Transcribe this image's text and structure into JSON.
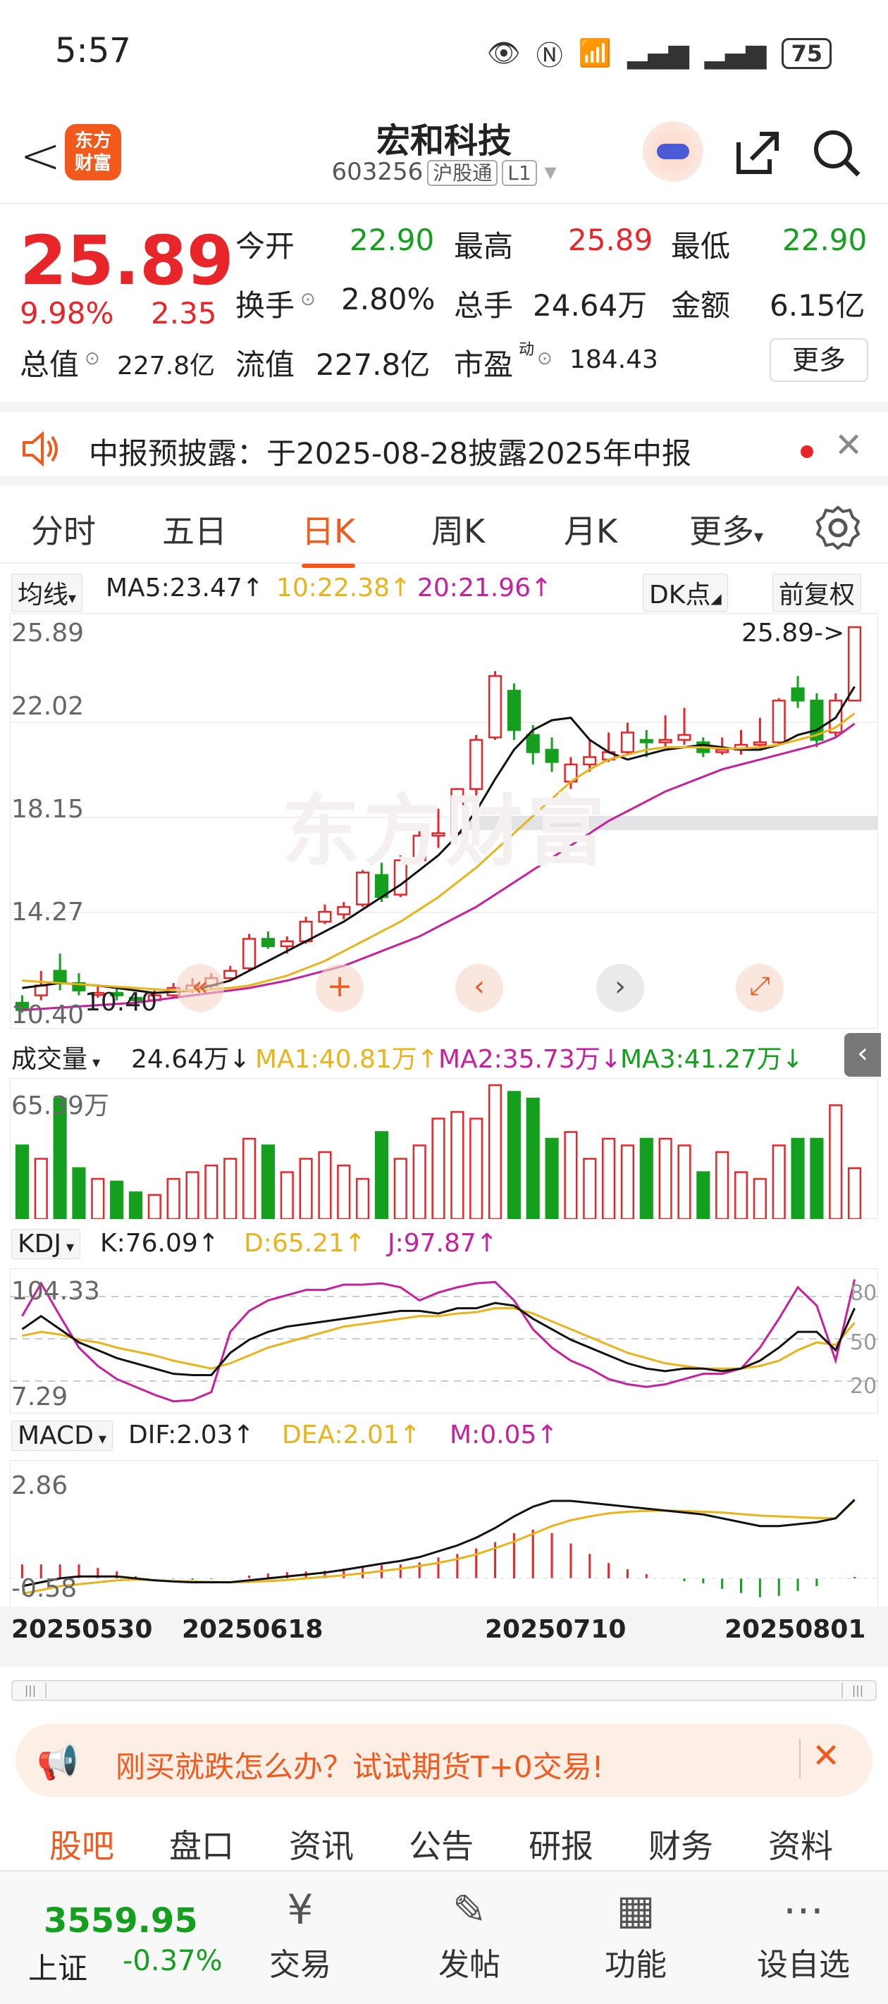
{
  "status_bar": {
    "time": "5:57",
    "battery": "75"
  },
  "header": {
    "back": "<",
    "logo_line1": "东方",
    "logo_line2": "财富",
    "title": "宏和科技",
    "code": "603256",
    "tag1": "沪股通",
    "tag2": "L1"
  },
  "quote": {
    "price": "25.89",
    "pct": "9.98%",
    "change": "2.35",
    "open_label": "今开",
    "open": "22.90",
    "high_label": "最高",
    "high": "25.89",
    "low_label": "最低",
    "low": "22.90",
    "turnover_label": "换手",
    "turnover": "2.80%",
    "volume_label": "总手",
    "volume": "24.64万",
    "amount_label": "金额",
    "amount": "6.15亿",
    "mcap_label": "总值",
    "mcap": "227.8亿",
    "float_label": "流值",
    "float": "227.8亿",
    "pe_label": "市盈",
    "pe_sup": "动",
    "pe": "184.43",
    "more": "更多"
  },
  "notice": {
    "text": "中报预披露：于2025-08-28披露2025年中报"
  },
  "tabs": [
    "分时",
    "五日",
    "日K",
    "周K",
    "月K",
    "更多"
  ],
  "active_tab": "日K",
  "ma_bar": {
    "select": "均线",
    "ma5": "MA5:23.47↑",
    "ma10": "10:22.38↑",
    "ma20": "20:21.96↑",
    "dk": "DK点",
    "fq": "前复权"
  },
  "kline": {
    "ylabels": [
      "25.89",
      "22.02",
      "18.15",
      "14.27",
      "10.40"
    ],
    "last_label": "25.89->",
    "low_label": "10.40",
    "watermark": "东方财富"
  },
  "vol_bar": {
    "select": "成交量",
    "vol": "24.64万↓",
    "ma1": "MA1:40.81万↑",
    "ma2": "MA2:35.73万↓",
    "ma3": "MA3:41.27万↓",
    "ymax": "65.39万"
  },
  "kdj_bar": {
    "select": "KDJ",
    "k": "K:76.09↑",
    "d": "D:65.21↑",
    "j": "J:97.87↑",
    "ymax": "104.33",
    "ymin": "7.29",
    "r80": "80",
    "r50": "50",
    "r20": "20"
  },
  "macd_bar": {
    "select": "MACD",
    "dif": "DIF:2.03↑",
    "dea": "DEA:2.01↑",
    "m": "M:0.05↑",
    "ymax": "2.86",
    "ymin": "-0.58"
  },
  "dates": [
    "20250530",
    "20250618",
    "20250710",
    "20250801"
  ],
  "banner": {
    "text": "刚买就跌怎么办？试试期货T+0交易!"
  },
  "subtabs": [
    "股吧",
    "盘口",
    "资讯",
    "公告",
    "研报",
    "财务",
    "资料"
  ],
  "index": {
    "value": "3559.95",
    "name": "上证",
    "pct": "-0.37%"
  },
  "bottom_nav": [
    {
      "label": "交易",
      "icon": "yen-icon"
    },
    {
      "label": "发帖",
      "icon": "edit-icon"
    },
    {
      "label": "功能",
      "icon": "grid-icon"
    },
    {
      "label": "设自选",
      "icon": "more-icon"
    }
  ],
  "colors": {
    "up": "#e8262a",
    "down": "#14a01e",
    "accent": "#f25a1d",
    "ma5": "#111111",
    "ma10": "#e8b41a",
    "ma20": "#c8209c"
  },
  "chart_data": {
    "type": "candlestick",
    "ylim": [
      10.4,
      25.89
    ],
    "dates_shown": [
      "20250530",
      "20250618",
      "20250710",
      "20250801"
    ],
    "candles": [
      {
        "o": 10.6,
        "c": 10.3,
        "h": 10.9,
        "l": 10.2
      },
      {
        "o": 10.9,
        "c": 11.3,
        "h": 11.9,
        "l": 10.7
      },
      {
        "o": 11.9,
        "c": 11.4,
        "h": 12.6,
        "l": 11.1
      },
      {
        "o": 11.4,
        "c": 11.1,
        "h": 11.8,
        "l": 10.9
      },
      {
        "o": 11.0,
        "c": 11.0,
        "h": 11.3,
        "l": 10.8
      },
      {
        "o": 11.0,
        "c": 10.9,
        "h": 11.2,
        "l": 10.7
      },
      {
        "o": 10.8,
        "c": 10.7,
        "h": 11.0,
        "l": 10.5
      },
      {
        "o": 10.7,
        "c": 10.9,
        "h": 11.1,
        "l": 10.6
      },
      {
        "o": 10.9,
        "c": 11.2,
        "h": 11.4,
        "l": 10.8
      },
      {
        "o": 11.1,
        "c": 11.3,
        "h": 11.6,
        "l": 11.0
      },
      {
        "o": 11.3,
        "c": 11.6,
        "h": 11.8,
        "l": 11.2
      },
      {
        "o": 11.6,
        "c": 11.9,
        "h": 12.1,
        "l": 11.5
      },
      {
        "o": 12.0,
        "c": 13.2,
        "h": 13.4,
        "l": 11.9
      },
      {
        "o": 13.2,
        "c": 12.9,
        "h": 13.5,
        "l": 12.8
      },
      {
        "o": 12.9,
        "c": 13.1,
        "h": 13.3,
        "l": 12.6
      },
      {
        "o": 13.1,
        "c": 13.9,
        "h": 14.1,
        "l": 13.0
      },
      {
        "o": 13.9,
        "c": 14.3,
        "h": 14.6,
        "l": 13.8
      },
      {
        "o": 14.2,
        "c": 14.5,
        "h": 14.7,
        "l": 14.0
      },
      {
        "o": 14.6,
        "c": 15.9,
        "h": 16.0,
        "l": 14.5
      },
      {
        "o": 15.8,
        "c": 14.9,
        "h": 16.3,
        "l": 14.7
      },
      {
        "o": 15.0,
        "c": 16.4,
        "h": 16.6,
        "l": 14.9
      },
      {
        "o": 16.4,
        "c": 17.4,
        "h": 17.6,
        "l": 16.3
      },
      {
        "o": 17.4,
        "c": 17.5,
        "h": 18.5,
        "l": 16.9
      },
      {
        "o": 17.5,
        "c": 19.3,
        "h": 19.3,
        "l": 17.4
      },
      {
        "o": 19.3,
        "c": 21.3,
        "h": 21.5,
        "l": 18.6
      },
      {
        "o": 21.4,
        "c": 23.9,
        "h": 24.1,
        "l": 21.3
      },
      {
        "o": 23.3,
        "c": 21.7,
        "h": 23.6,
        "l": 21.3
      },
      {
        "o": 21.5,
        "c": 20.8,
        "h": 21.9,
        "l": 20.3
      },
      {
        "o": 20.9,
        "c": 20.4,
        "h": 21.4,
        "l": 20.0
      },
      {
        "o": 19.6,
        "c": 20.3,
        "h": 20.6,
        "l": 19.3
      },
      {
        "o": 20.3,
        "c": 20.6,
        "h": 21.3,
        "l": 20.0
      },
      {
        "o": 20.5,
        "c": 20.8,
        "h": 21.6,
        "l": 20.4
      },
      {
        "o": 20.8,
        "c": 21.6,
        "h": 22.0,
        "l": 20.7
      },
      {
        "o": 21.3,
        "c": 21.2,
        "h": 21.7,
        "l": 20.6
      },
      {
        "o": 21.2,
        "c": 21.3,
        "h": 22.3,
        "l": 21.0
      },
      {
        "o": 21.3,
        "c": 21.5,
        "h": 22.6,
        "l": 21.1
      },
      {
        "o": 21.2,
        "c": 20.8,
        "h": 21.4,
        "l": 20.6
      },
      {
        "o": 20.8,
        "c": 20.9,
        "h": 21.4,
        "l": 20.7
      },
      {
        "o": 20.9,
        "c": 21.1,
        "h": 21.7,
        "l": 20.7
      },
      {
        "o": 21.1,
        "c": 21.2,
        "h": 22.2,
        "l": 20.9
      },
      {
        "o": 21.2,
        "c": 22.9,
        "h": 23.0,
        "l": 21.1
      },
      {
        "o": 23.4,
        "c": 22.9,
        "h": 23.9,
        "l": 22.6
      },
      {
        "o": 22.9,
        "c": 21.3,
        "h": 23.2,
        "l": 21.0
      },
      {
        "o": 21.6,
        "c": 22.9,
        "h": 23.2,
        "l": 21.4
      },
      {
        "o": 22.9,
        "c": 25.89,
        "h": 25.89,
        "l": 22.9
      }
    ],
    "ma5": [
      11.2,
      11.3,
      11.4,
      11.35,
      11.3,
      11.2,
      11.1,
      11.0,
      11.05,
      11.1,
      11.3,
      11.5,
      11.9,
      12.3,
      12.7,
      13.1,
      13.5,
      13.9,
      14.4,
      14.9,
      15.4,
      16.0,
      16.6,
      17.4,
      18.4,
      19.7,
      20.9,
      21.7,
      22.1,
      22.2,
      21.3,
      20.8,
      20.5,
      20.7,
      20.9,
      21.0,
      21.1,
      21.0,
      20.9,
      20.9,
      21.1,
      21.5,
      21.7,
      22.2,
      23.47
    ],
    "ma10": [
      11.5,
      11.45,
      11.4,
      11.35,
      11.3,
      11.25,
      11.2,
      11.15,
      11.1,
      11.1,
      11.15,
      11.2,
      11.3,
      11.5,
      11.7,
      12.0,
      12.3,
      12.7,
      13.1,
      13.5,
      13.9,
      14.4,
      14.9,
      15.5,
      16.1,
      16.8,
      17.5,
      18.2,
      18.9,
      19.6,
      20.1,
      20.5,
      20.7,
      20.9,
      21.0,
      21.0,
      21.0,
      20.95,
      20.95,
      21.0,
      21.1,
      21.3,
      21.5,
      21.8,
      22.38
    ],
    "ma20": [
      10.3,
      10.35,
      10.4,
      10.45,
      10.5,
      10.55,
      10.6,
      10.7,
      10.8,
      10.9,
      11.0,
      11.1,
      11.2,
      11.35,
      11.5,
      11.7,
      11.9,
      12.1,
      12.4,
      12.7,
      13.0,
      13.3,
      13.7,
      14.1,
      14.5,
      15.0,
      15.5,
      16.0,
      16.5,
      17.0,
      17.5,
      18.0,
      18.4,
      18.8,
      19.2,
      19.5,
      19.8,
      20.1,
      20.3,
      20.5,
      20.7,
      20.9,
      21.1,
      21.4,
      21.96
    ]
  }
}
